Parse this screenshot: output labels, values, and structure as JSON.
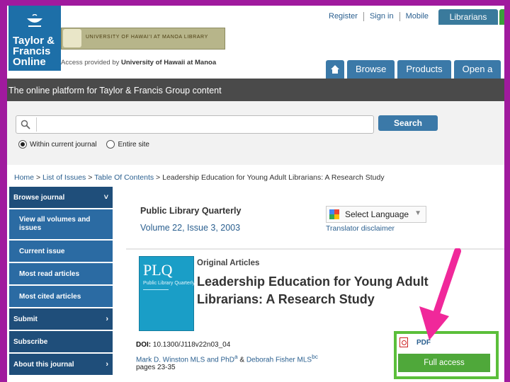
{
  "header": {
    "logo_text": "Taylor & Francis Online",
    "institution_banner": "UNIVERSITY OF HAWAI'I AT MANOA LIBRARY",
    "access_prefix": "Access provided by",
    "access_institution": "University of Hawaii at Manoa",
    "top_links": [
      "Register",
      "Sign in",
      "Mobile"
    ],
    "librarians_tab": "Librarians",
    "nav": [
      "Browse",
      "Products",
      "Open a"
    ],
    "banner": "The online platform for Taylor & Francis Group content"
  },
  "search": {
    "placeholder": "",
    "button": "Search",
    "option_current": "Within current journal",
    "option_site": "Entire site"
  },
  "breadcrumb": {
    "home": "Home",
    "issues": "List of Issues",
    "toc": "Table Of Contents",
    "current": "Leadership Education for Young Adult Librarians: A Research Study",
    "sep": ">"
  },
  "sidebar": {
    "items": [
      {
        "label": "Browse journal",
        "chev": "˅"
      },
      {
        "label": "View all volumes and issues"
      },
      {
        "label": "Current issue"
      },
      {
        "label": "Most read articles"
      },
      {
        "label": "Most cited articles"
      },
      {
        "label": "Submit",
        "chev": "›"
      },
      {
        "label": "Subscribe"
      },
      {
        "label": "About this journal",
        "chev": "›"
      }
    ]
  },
  "article": {
    "journal": "Public Library Quarterly",
    "volume": "Volume 22, Issue 3, 2003",
    "translate": "Select Language",
    "disclaimer": "Translator disclaimer",
    "type": "Original Articles",
    "title": "Leadership Education for Young Adult Librarians: A Research Study",
    "doi_label": "DOI:",
    "doi": "10.1300/J118v22n03_04",
    "author1": "Mark D. Winston MLS and PhD",
    "author1_sup": "a",
    "and": "&",
    "author2": "Deborah Fisher MLS",
    "author2_sup": "bc",
    "pages": "pages 23-35",
    "cover_title": "PLQ",
    "cover_sub": "Public Library Quarterly"
  },
  "access": {
    "pdf": "PDF",
    "full": "Full access"
  },
  "colors": {
    "frame": "#a01a9e",
    "nav_blue": "#3b79a8",
    "sidebar_blue": "#1f4e7a",
    "green": "#5bbf3a",
    "arrow": "#f0289a"
  }
}
